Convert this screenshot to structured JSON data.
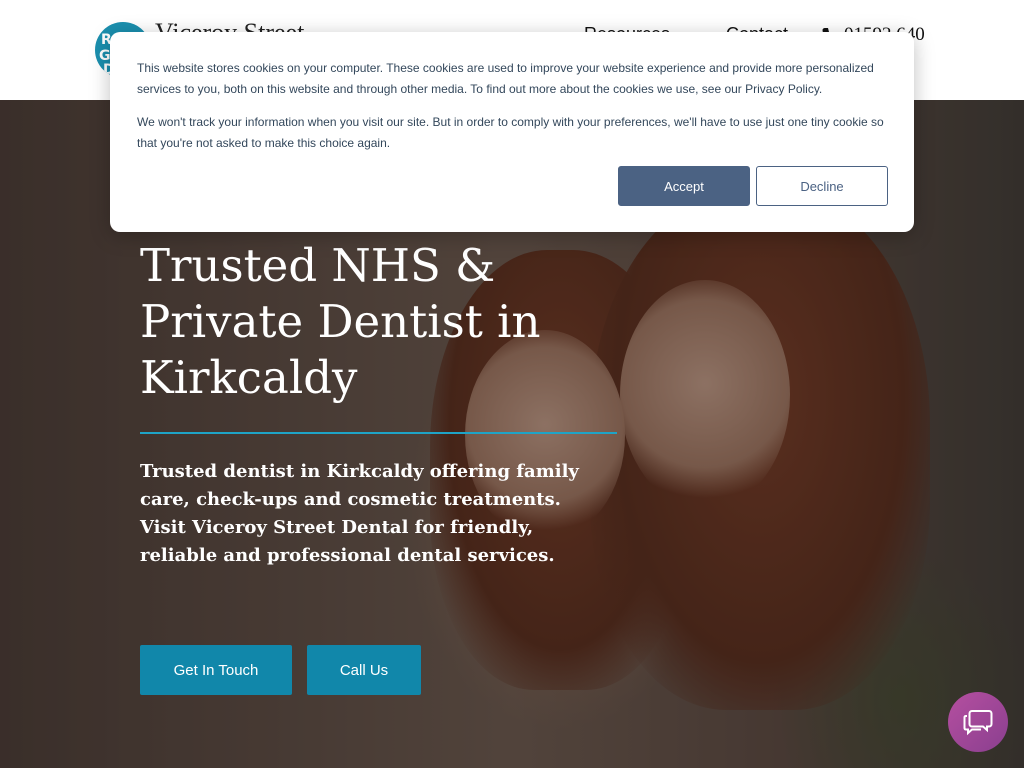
{
  "header": {
    "logo_text": "Viceroy Street",
    "logo_letters": [
      "R",
      "G",
      "D"
    ],
    "nav": [
      {
        "label": "Resources"
      },
      {
        "label": "Contact"
      }
    ],
    "phone": "01592 640"
  },
  "hero": {
    "title": "Trusted NHS & Private Dentist in Kirkcaldy",
    "subtitle": "Trusted dentist in Kirkcaldy offering family care, check-ups and cosmetic treatments. Visit Viceroy Street Dental for friendly, reliable and professional dental services.",
    "buttons": {
      "get_in_touch": "Get In Touch",
      "call_us": "Call Us"
    }
  },
  "cookie_banner": {
    "paragraph1": "This website stores cookies on your computer. These cookies are used to improve your website experience and provide more personalized services to you, both on this website and through other media. To find out more about the cookies we use, see our Privacy Policy.",
    "paragraph2": "We won't track your information when you visit our site. But in order to comply with your preferences, we'll have to use just one tiny cookie so that you're not asked to make this choice again.",
    "accept_label": "Accept",
    "decline_label": "Decline"
  },
  "chat": {
    "icon": "chat-icon"
  },
  "colors": {
    "brand_teal": "#1187aa",
    "accent_rule": "#1ea4c7",
    "cookie_button": "#4b6283",
    "chat_bubble": "#a0479a"
  }
}
